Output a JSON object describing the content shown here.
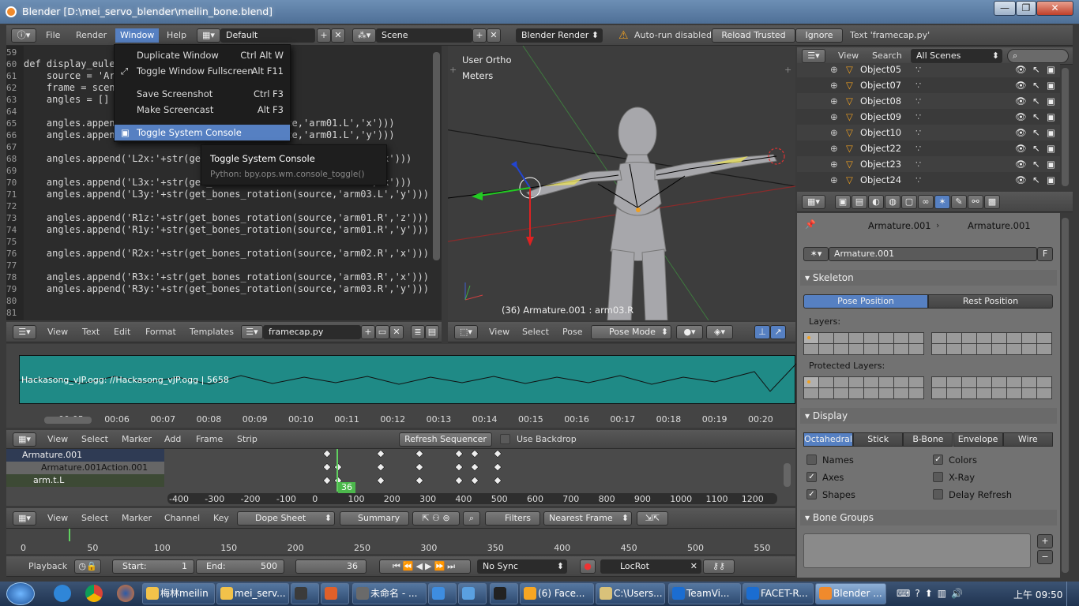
{
  "window": {
    "title": "Blender [D:\\mei_servo_blender\\meilin_bone.blend]",
    "min": "—",
    "max": "❐",
    "close": "✕"
  },
  "topbar": {
    "menus": [
      "File",
      "Render",
      "Window",
      "Help"
    ],
    "layout": "Default",
    "scene_label": "Scene",
    "engine": "Blender Render",
    "autorun": "Auto-run disabled",
    "reload": "Reload Trusted",
    "ignore": "Ignore",
    "status": "Text 'framecap.py'"
  },
  "window_menu": {
    "items": [
      {
        "label": "Duplicate Window",
        "shortcut": "Ctrl Alt W"
      },
      {
        "label": "Toggle Window Fullscreen",
        "shortcut": "Alt F11"
      },
      {
        "label": "Save Screenshot",
        "shortcut": "Ctrl F3"
      },
      {
        "label": "Make Screencast",
        "shortcut": "Alt F3"
      },
      {
        "label": "Toggle System Console",
        "shortcut": ""
      }
    ]
  },
  "tooltip": {
    "title": "Toggle System Console",
    "python": "Python: bpy.ops.wm.console_toggle()"
  },
  "code": [
    {
      "n": "59",
      "t": ""
    },
    {
      "n": "60",
      "t": "def display_eule"
    },
    {
      "n": "61",
      "t": "    source = 'Ar"
    },
    {
      "n": "62",
      "t": "    frame = scen"
    },
    {
      "n": "63",
      "t": "    angles = []"
    },
    {
      "n": "64",
      "t": ""
    },
    {
      "n": "65",
      "t": "    angles.append                        (source,'arm01.L','x')))"
    },
    {
      "n": "66",
      "t": "    angles.append                        (source,'arm01.L','y')))"
    },
    {
      "n": "67",
      "t": ""
    },
    {
      "n": "68",
      "t": "    angles.append('L2x:'+str(get_bo                          ,'x')))"
    },
    {
      "n": "69",
      "t": ""
    },
    {
      "n": "70",
      "t": "    angles.append('L3x:'+str(get_bo                          ,'x')))"
    },
    {
      "n": "71",
      "t": "    angles.append('L3y:'+str(get_bones_rotation(source,'arm03.L','y')))"
    },
    {
      "n": "72",
      "t": ""
    },
    {
      "n": "73",
      "t": "    angles.append('R1z:'+str(get_bones_rotation(source,'arm01.R','z')))"
    },
    {
      "n": "74",
      "t": "    angles.append('R1y:'+str(get_bones_rotation(source,'arm01.R','y')))"
    },
    {
      "n": "75",
      "t": ""
    },
    {
      "n": "76",
      "t": "    angles.append('R2x:'+str(get_bones_rotation(source,'arm02.R','x')))"
    },
    {
      "n": "77",
      "t": ""
    },
    {
      "n": "78",
      "t": "    angles.append('R3x:'+str(get_bones_rotation(source,'arm03.R','x')))"
    },
    {
      "n": "79",
      "t": "    angles.append('R3y:'+str(get_bones_rotation(source,'arm03.R','y')))"
    },
    {
      "n": "80",
      "t": ""
    },
    {
      "n": "81",
      "t": ""
    }
  ],
  "text_header": {
    "menus": [
      "View",
      "Text",
      "Edit",
      "Format",
      "Templates"
    ],
    "file": "framecap.py"
  },
  "viewport": {
    "view": "User Ortho",
    "units": "Meters",
    "status": "(36) Armature.001 : arm03.R",
    "menus": [
      "View",
      "Select",
      "Pose"
    ],
    "mode": "Pose Mode"
  },
  "outliner": {
    "menus": [
      "View",
      "Search"
    ],
    "filter": "All Scenes",
    "objects": [
      "Object05",
      "Object07",
      "Object08",
      "Object09",
      "Object10",
      "Object22",
      "Object23",
      "Object24"
    ]
  },
  "props": {
    "crumb1": "Armature.001",
    "crumb2": "Armature.001",
    "name": "Armature.001",
    "f": "F",
    "skeleton": "Skeleton",
    "pose": "Pose Position",
    "rest": "Rest Position",
    "layers": "Layers:",
    "protected": "Protected Layers:",
    "display": "Display",
    "modes": [
      "Octahedral",
      "Stick",
      "B-Bone",
      "Envelope",
      "Wire"
    ],
    "checks": [
      {
        "label": "Names",
        "on": false
      },
      {
        "label": "Colors",
        "on": true
      },
      {
        "label": "Axes",
        "on": true
      },
      {
        "label": "X-Ray",
        "on": false
      },
      {
        "label": "Shapes",
        "on": true
      },
      {
        "label": "Delay Refresh",
        "on": false
      }
    ],
    "bone_groups": "Bone Groups"
  },
  "sequencer": {
    "strip": "Hackasong_vJP.ogg: //Hackasong_vJP.ogg | 5658",
    "times": [
      "00:05",
      "00:06",
      "00:07",
      "00:08",
      "00:09",
      "00:10",
      "00:11",
      "00:12",
      "00:13",
      "00:14",
      "00:15",
      "00:16",
      "00:17",
      "00:18",
      "00:19",
      "00:20"
    ],
    "menus": [
      "View",
      "Select",
      "Marker",
      "Add",
      "Frame",
      "Strip"
    ],
    "refresh": "Refresh Sequencer",
    "backdrop": "Use Backdrop"
  },
  "dopesheet": {
    "channels": [
      "Armature.001",
      "Armature.001Action.001",
      "arm.t.L"
    ],
    "frame": "36",
    "ticks": [
      "-400",
      "-300",
      "-200",
      "-100",
      "0",
      "100",
      "200",
      "300",
      "400",
      "500",
      "600",
      "700",
      "800",
      "900",
      "1000",
      "1100",
      "1200"
    ],
    "menus": [
      "View",
      "Select",
      "Marker",
      "Channel",
      "Key"
    ],
    "mode": "Dope Sheet",
    "summary": "Summary",
    "filters": "Filters",
    "snap": "Nearest Frame"
  },
  "timeline": {
    "ticks": [
      "0",
      "50",
      "100",
      "150",
      "200",
      "250",
      "300",
      "350",
      "400",
      "450",
      "500",
      "550"
    ],
    "playback": "Playback",
    "start_label": "Start:",
    "start": "1",
    "end_label": "End:",
    "end": "500",
    "current": "36",
    "sync": "No Sync",
    "keying": "LocRot"
  },
  "taskbar": {
    "items": [
      "梅林meilin",
      "mei_serv...",
      "",
      "",
      "未命名 - ...",
      "",
      "",
      "",
      "(6) Face...",
      "C:\\Users...",
      "TeamVi...",
      "FACET-R...",
      "Blender ..."
    ],
    "clock": "上午 09:50"
  }
}
